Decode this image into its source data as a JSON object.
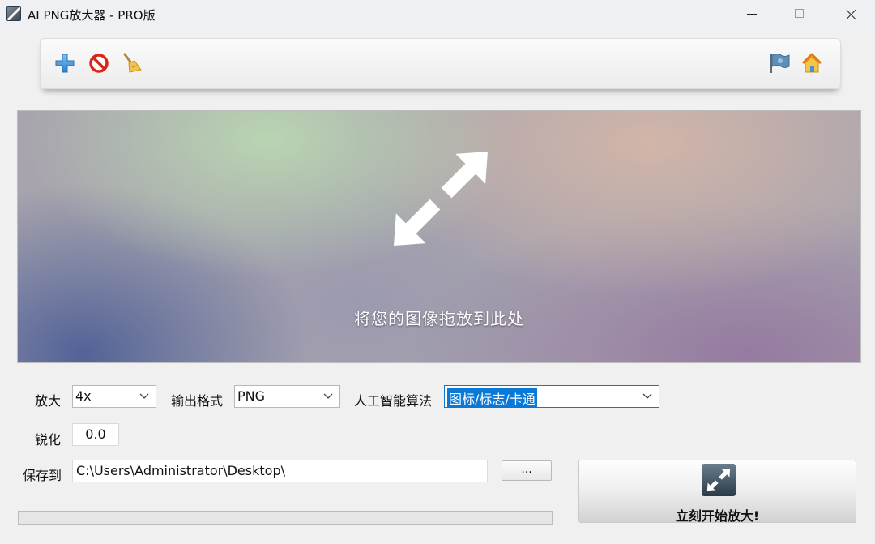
{
  "window": {
    "title": "AI PNG放大器 - PRO版"
  },
  "toolbar": {
    "icons": [
      "add-icon",
      "stop-icon",
      "broom-icon",
      "flag-icon",
      "home-icon"
    ]
  },
  "dropzone": {
    "hint": "将您的图像拖放到此处"
  },
  "settings": {
    "scale_label": "放大",
    "scale_value": "4x",
    "format_label": "输出格式",
    "format_value": "PNG",
    "algorithm_label": "人工智能算法",
    "algorithm_value": "图标/标志/卡通",
    "sharpen_label": "锐化",
    "sharpen_value": "0.0",
    "save_label": "保存到",
    "save_path": "C:\\Users\\Administrator\\Desktop\\",
    "browse_label": "..."
  },
  "progress": {
    "value": 0
  },
  "start_button": {
    "label": "立刻开始放大!"
  },
  "colors": {
    "accent": "#0a78d7",
    "progress": "#06b025"
  }
}
